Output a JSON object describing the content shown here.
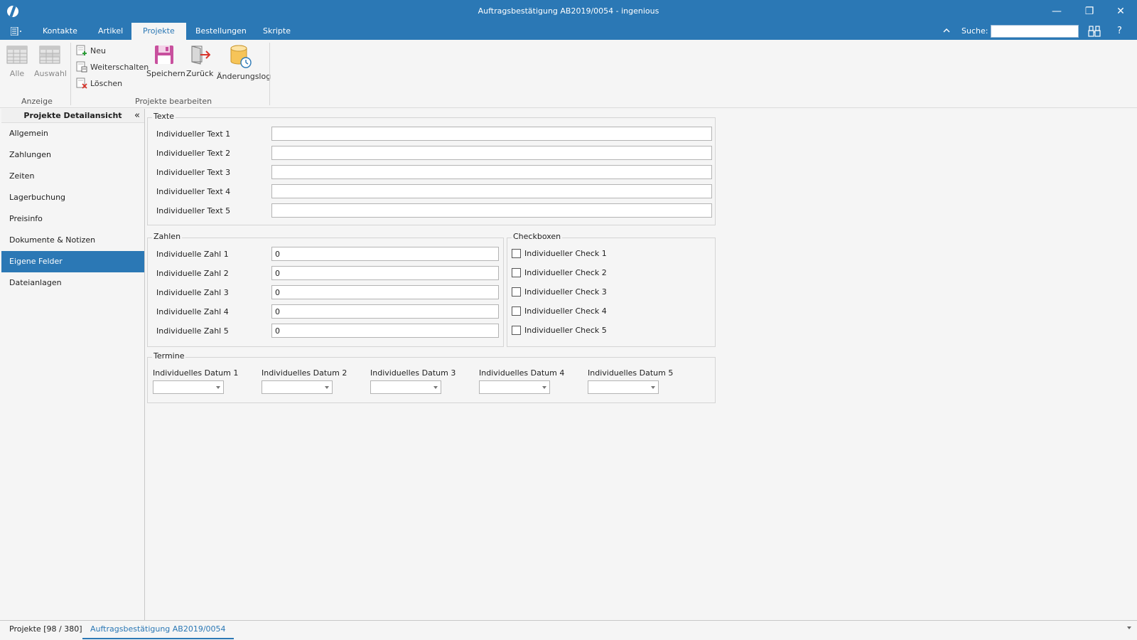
{
  "window": {
    "title": "Auftragsbestätigung AB2019/0054 - ingenious",
    "controls": {
      "minimize": "—",
      "restore": "❐",
      "close": "✕"
    }
  },
  "ribbon_tabs": [
    {
      "label": "Kontakte"
    },
    {
      "label": "Artikel"
    },
    {
      "label": "Projekte"
    },
    {
      "label": "Bestellungen"
    },
    {
      "label": "Skripte"
    }
  ],
  "search": {
    "label": "Suche:",
    "value": "",
    "placeholder": ""
  },
  "help": "?",
  "ribbon": {
    "anzeige": {
      "label": "Anzeige",
      "alle": "Alle",
      "auswahl": "Auswahl"
    },
    "bearbeiten": {
      "label": "Projekte bearbeiten",
      "neu": "Neu",
      "weiterschalten": "Weiterschalten",
      "loeschen": "Löschen",
      "speichern": "Speichern",
      "zurueck": "Zurück",
      "aenderungslog": "Änderungslog"
    }
  },
  "sidebar": {
    "title": "Projekte Detailansicht",
    "items": [
      {
        "label": "Allgemein"
      },
      {
        "label": "Zahlungen"
      },
      {
        "label": "Zeiten"
      },
      {
        "label": "Lagerbuchung"
      },
      {
        "label": "Preisinfo"
      },
      {
        "label": "Dokumente & Notizen"
      },
      {
        "label": "Eigene Felder"
      },
      {
        "label": "Dateianlagen"
      }
    ]
  },
  "texte": {
    "title": "Texte",
    "fields": [
      {
        "label": "Individueller Text 1",
        "value": ""
      },
      {
        "label": "Individueller Text 2",
        "value": ""
      },
      {
        "label": "Individueller Text 3",
        "value": ""
      },
      {
        "label": "Individueller Text 4",
        "value": ""
      },
      {
        "label": "Individueller Text 5",
        "value": ""
      }
    ]
  },
  "zahlen": {
    "title": "Zahlen",
    "fields": [
      {
        "label": "Individuelle Zahl 1",
        "value": "0"
      },
      {
        "label": "Individuelle Zahl 2",
        "value": "0"
      },
      {
        "label": "Individuelle Zahl 3",
        "value": "0"
      },
      {
        "label": "Individuelle Zahl 4",
        "value": "0"
      },
      {
        "label": "Individuelle Zahl 5",
        "value": "0"
      }
    ]
  },
  "checkboxen": {
    "title": "Checkboxen",
    "items": [
      {
        "label": "Individueller Check 1"
      },
      {
        "label": "Individueller Check 2"
      },
      {
        "label": "Individueller Check 3"
      },
      {
        "label": "Individueller Check 4"
      },
      {
        "label": "Individueller Check 5"
      }
    ]
  },
  "termine": {
    "title": "Termine",
    "dates": [
      {
        "label": "Individuelles Datum 1"
      },
      {
        "label": "Individuelles Datum 2"
      },
      {
        "label": "Individuelles Datum 3"
      },
      {
        "label": "Individuelles Datum 4"
      },
      {
        "label": "Individuelles Datum 5"
      }
    ]
  },
  "doc_tabs": [
    {
      "label": "Projekte [98 / 380]"
    },
    {
      "label": "Auftragsbestätigung AB2019/0054"
    }
  ],
  "colors": {
    "accent": "#2b78b5",
    "background": "#f5f5f5"
  }
}
